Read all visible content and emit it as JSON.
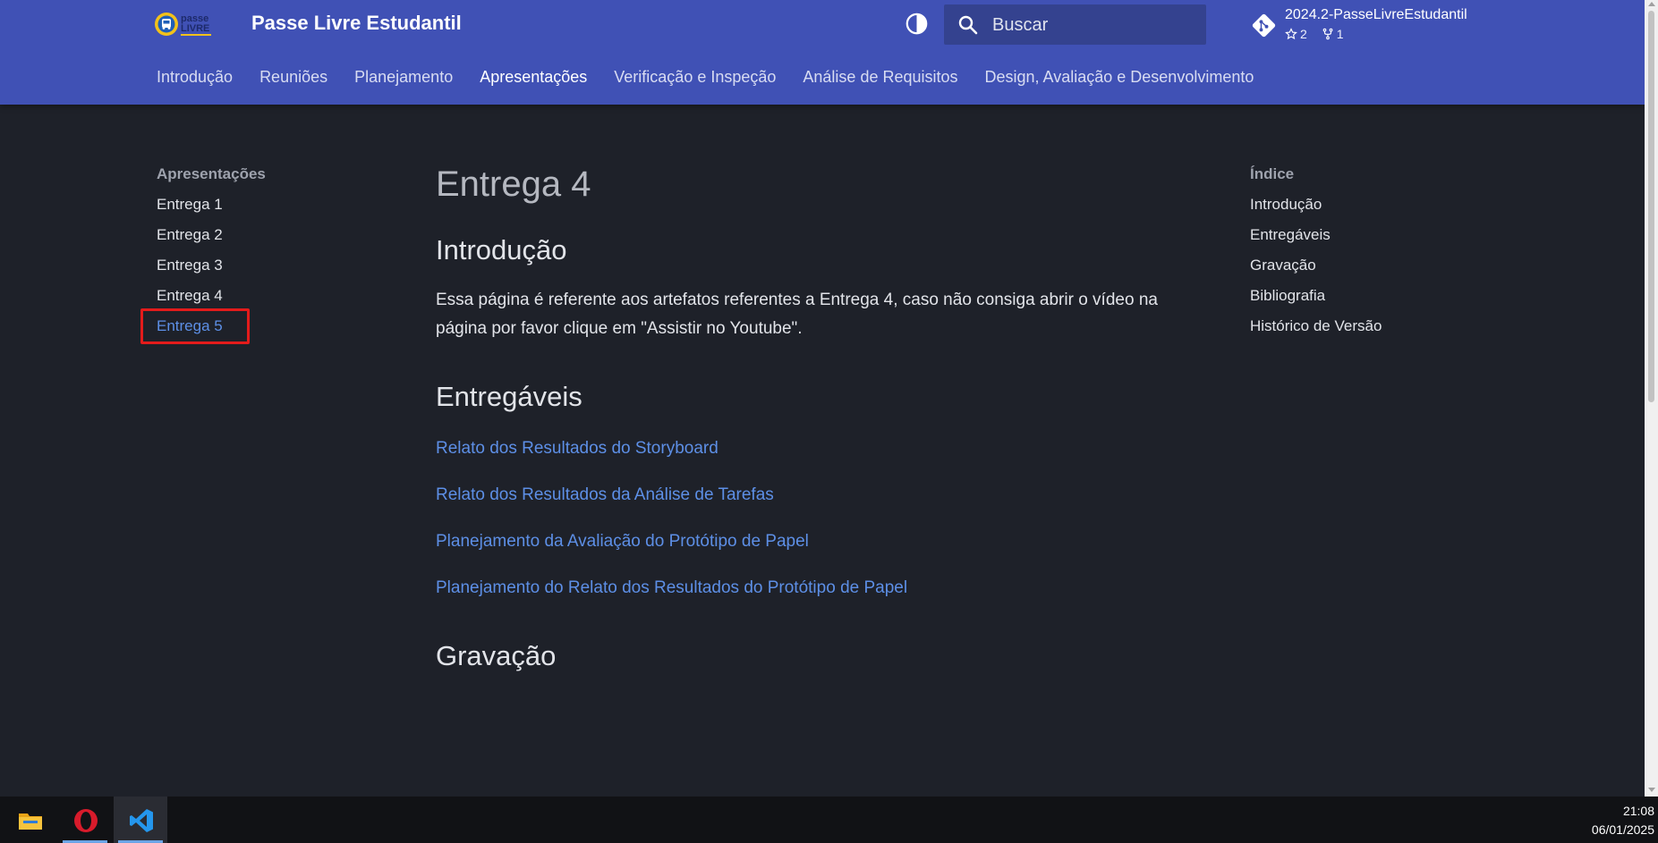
{
  "header": {
    "logo_text": "passe LIVRE",
    "site_title": "Passe Livre Estudantil",
    "search_placeholder": "Buscar",
    "repo": {
      "name": "2024.2-PasseLivreEstudantil",
      "stars": "2",
      "forks": "1"
    },
    "tabs": [
      {
        "label": "Introdução"
      },
      {
        "label": "Reuniões"
      },
      {
        "label": "Planejamento"
      },
      {
        "label": "Apresentações"
      },
      {
        "label": "Verificação e Inspeção"
      },
      {
        "label": "Análise de Requisitos"
      },
      {
        "label": "Design, Avaliação e Desenvolvimento"
      }
    ]
  },
  "left_nav": {
    "title": "Apresentações",
    "items": [
      {
        "label": "Entrega 1"
      },
      {
        "label": "Entrega 2"
      },
      {
        "label": "Entrega 3"
      },
      {
        "label": "Entrega 4"
      },
      {
        "label": "Entrega 5"
      }
    ]
  },
  "main": {
    "title": "Entrega 4",
    "sections": {
      "introducao": {
        "heading": "Introdução",
        "text": "Essa página é referente aos artefatos referentes a Entrega 4, caso não consiga abrir o vídeo na página por favor clique em \"Assistir no Youtube\"."
      },
      "entregaveis": {
        "heading": "Entregáveis",
        "links": [
          {
            "label": "Relato dos Resultados do Storyboard"
          },
          {
            "label": "Relato dos Resultados da Análise de Tarefas"
          },
          {
            "label": "Planejamento da Avaliação do Protótipo de Papel"
          },
          {
            "label": "Planejamento do Relato dos Resultados do Protótipo de Papel"
          }
        ]
      },
      "gravacao": {
        "heading": "Gravação"
      }
    }
  },
  "toc": {
    "title": "Índice",
    "items": [
      {
        "label": "Introdução"
      },
      {
        "label": "Entregáveis"
      },
      {
        "label": "Gravação"
      },
      {
        "label": "Bibliografia"
      },
      {
        "label": "Histórico de Versão"
      }
    ]
  },
  "taskbar": {
    "apps": [
      {
        "icon": "file-explorer-icon"
      },
      {
        "icon": "opera-icon"
      },
      {
        "icon": "vscode-icon"
      }
    ],
    "time": "21:08",
    "date": "06/01/2025"
  },
  "colors": {
    "header_bg": "#4051b5",
    "page_bg": "#1e2129",
    "link": "#5d8fe6",
    "highlight_border": "#e31b1b"
  }
}
